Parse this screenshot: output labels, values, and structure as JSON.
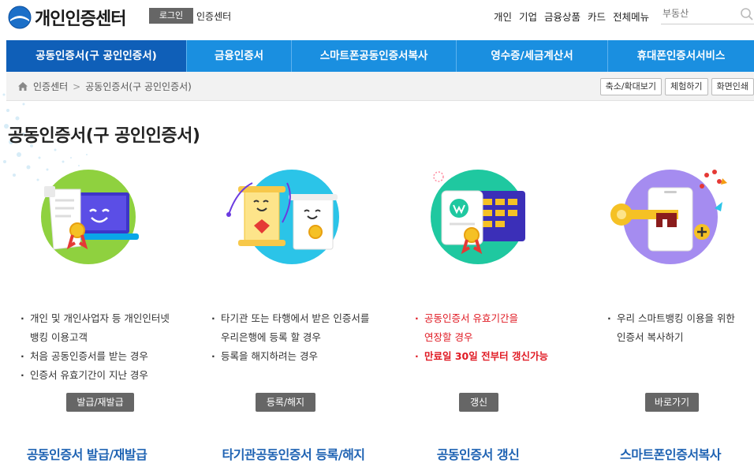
{
  "header": {
    "logo_text": "개인인증센터",
    "login_label": "로그인",
    "site_name": "인증센터",
    "util_nav": [
      "개인",
      "기업",
      "금융상품",
      "카드",
      "전체메뉴"
    ],
    "search_placeholder": "부동산"
  },
  "gnb": [
    {
      "label": "공동인증서(구 공인인증서)",
      "active": true
    },
    {
      "label": "금융인증서"
    },
    {
      "label": "스마트폰공동인증서복사"
    },
    {
      "label": "영수증/세금계산서"
    },
    {
      "label": "휴대폰인증서서비스"
    }
  ],
  "breadcrumb": {
    "items": [
      "인증센터",
      "공동인증서(구 공인인증서)"
    ],
    "separator": ">",
    "tools": [
      "축소/확대보기",
      "체험하기",
      "화면인쇄"
    ]
  },
  "page_title": "공동인증서(구 공인인증서)",
  "cards": [
    {
      "icon": "laptop-certificate-icon",
      "title": "공동인증서 발급/재발급",
      "bullets": [
        {
          "text": "개인 및 개인사업자 등 개인인터넷"
        },
        {
          "text": "뱅킹 이용고객",
          "cont": true
        },
        {
          "text": "처음 공동인증서를 받는 경우"
        },
        {
          "text": "인증서 유효기간이 지난 경우"
        }
      ],
      "button": "발급/재발급"
    },
    {
      "icon": "certificate-transfer-icon",
      "title": "타기관공동인증서 등록/해지",
      "bullets": [
        {
          "text": "타기관 또는 타행에서 받은 인증서를"
        },
        {
          "text": "우리은행에 등록 할 경우",
          "cont": true
        },
        {
          "text": "등록을 해지하려는 경우"
        }
      ],
      "button": "등록/해지"
    },
    {
      "icon": "certificate-calendar-icon",
      "title": "공동인증서 갱신",
      "bullets": [
        {
          "text": "공동인증서 유효기간을",
          "red": true
        },
        {
          "text": "연장할 경우",
          "red": true,
          "cont": true
        },
        {
          "text": "만료일 30일 전부터 갱신가능",
          "red": true
        }
      ],
      "button": "갱신"
    },
    {
      "icon": "smartphone-key-icon",
      "title": "스마트폰인증서복사",
      "bullets": [
        {
          "text": "우리 스마트뱅킹 이용을 위한"
        },
        {
          "text": "인증서 복사하기",
          "cont": true
        }
      ],
      "button": "바로가기"
    }
  ],
  "colors": {
    "gnb": "#1a8fe0",
    "gnb_active": "#0f5fb8",
    "title_blue": "#1f63b3",
    "red": "#e01b24"
  }
}
